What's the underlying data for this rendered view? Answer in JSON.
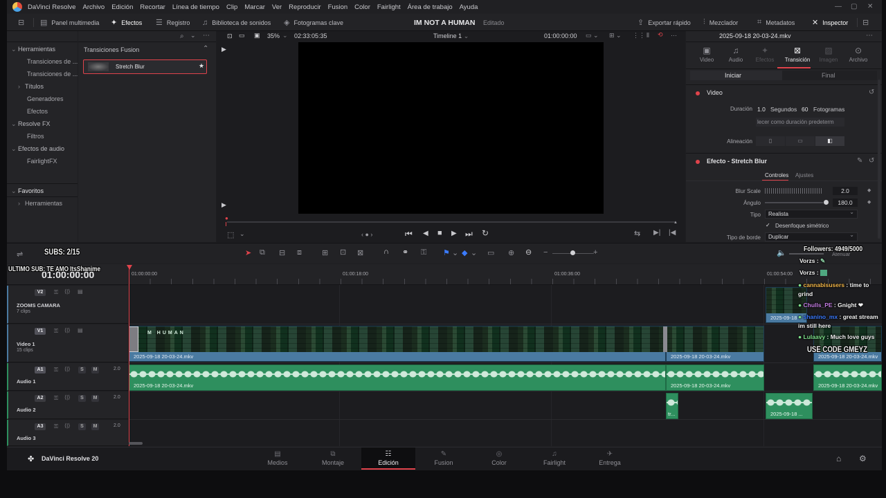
{
  "menu": {
    "app_name": "DaVinci Resolve",
    "items": [
      "Archivo",
      "Edición",
      "Recortar",
      "Línea de tiempo",
      "Clip",
      "Marcar",
      "Ver",
      "Reproducir",
      "Fusion",
      "Color",
      "Fairlight",
      "Área de trabajo",
      "Ayuda"
    ]
  },
  "toolbar": {
    "left": [
      "Panel multimedia",
      "Efectos",
      "Registro",
      "Biblioteca de sonidos",
      "Fotogramas clave"
    ],
    "project_title": "IM NOT A HUMAN",
    "project_status": "Editado",
    "right": [
      "Exportar rápido",
      "Mezclador",
      "Metadatos",
      "Inspector"
    ]
  },
  "effects_library": {
    "tree": {
      "herramientas": "Herramientas",
      "transiciones1": "Transiciones de ...",
      "transiciones2": "Transiciones de ...",
      "titulos": "Títulos",
      "generadores": "Generadores",
      "efectos": "Efectos",
      "resolve_fx": "Resolve FX",
      "filtros": "Filtros",
      "efectos_audio": "Efectos de audio",
      "fairlight_fx": "FairlightFX",
      "favoritos": "Favoritos",
      "fav_herramientas": "Herramientas"
    },
    "section_title": "Transiciones Fusion",
    "selected_item": "Stretch Blur"
  },
  "viewer": {
    "zoom": "35%",
    "source_timecode": "02:33:05:35",
    "timeline_name": "Timeline 1",
    "record_timecode": "01:00:00:00"
  },
  "inspector": {
    "clip_name": "2025-09-18 20-03-24.mkv",
    "tabs": [
      "Video",
      "Audio",
      "Efectos",
      "Transición",
      "Imagen",
      "Archivo"
    ],
    "active_tab": "Transición",
    "subtabs": [
      "Iniciar",
      "Final"
    ],
    "video_section": "Video",
    "duracion_label": "Duración",
    "duracion_value": "1.0",
    "segundos_label": "Segundos",
    "fotogramas_value": "60",
    "fotogramas_label": "Fotogramas",
    "default_button": "lecer como duración predeterm",
    "alineacion_label": "Alineación",
    "effect_section": "Efecto - Stretch Blur",
    "effect_tabs": [
      "Controles",
      "Ajustes"
    ],
    "blur_scale_label": "Blur Scale",
    "blur_scale_value": "2.0",
    "blur_scale_fraction": 0.2,
    "angulo_label": "Ángulo",
    "angulo_value": "180.0",
    "angulo_fraction": 1.0,
    "tipo_label": "Tipo",
    "tipo_value": "Realista",
    "desenfoque_label": "Desenfoque simétrico",
    "tipo_borde_label": "Tipo de borde",
    "tipo_borde_value": "Duplicar"
  },
  "timeline": {
    "current_tc": "01:00:00:00",
    "ruler": [
      "01:00:00:00",
      "01:00:18:00",
      "01:00:36:00",
      "01:00:54:00"
    ],
    "tracks": [
      {
        "id": "V2",
        "name": "ZOOMS CAMARA",
        "clips": "7 clips"
      },
      {
        "id": "V1",
        "name": "Video 1",
        "clips": "15 clips"
      },
      {
        "id": "A1",
        "name": "Audio 1",
        "level": "2.0"
      },
      {
        "id": "A2",
        "name": "Audio 2",
        "level": "2.0"
      },
      {
        "id": "A3",
        "name": "Audio 3",
        "level": "2.0"
      }
    ],
    "clip_name": "2025-09-18 20-03-24.mkv",
    "clip_short": "2025-09-18 ...",
    "clip_tiny": "tr...",
    "v2_clip": "2025-09-18",
    "solo_label": "S",
    "mute_label": "M",
    "thumb_text": "M HUMAN",
    "mixer_label": "Atenuar"
  },
  "pages": [
    "Medios",
    "Montaje",
    "Edición",
    "Fusion",
    "Color",
    "Fairlight",
    "Entrega"
  ],
  "active_page": "Edición",
  "brand": "DaVinci Resolve 20",
  "stream_overlay": {
    "subs": "SUBS: 2/15",
    "last_sub": "ULTIMO SUB: TE AMO ItsShanime",
    "followers": "Followers: 4949/5000",
    "code": "USE CODE GMEYZ",
    "chat": [
      {
        "user": "Vorzs",
        "msg": "",
        "color": "#f2f2f2"
      },
      {
        "user": "Vorzs",
        "msg": "",
        "color": "#f2f2f2"
      },
      {
        "user": "cannabisusers",
        "msg": "time to grind",
        "color": "#f5b84a"
      },
      {
        "user": "Chulls_PE",
        "msg": "Gnight ❤",
        "color": "#c27be0"
      },
      {
        "user": "shanino_mx",
        "msg": "great stream im still here",
        "color": "#3b7bff"
      },
      {
        "user": "Lulaavy",
        "msg": "Much love guys",
        "color": "#7de08a"
      }
    ]
  },
  "colors": {
    "accent": "#e0434b",
    "video_clip": "#4a7aa1",
    "audio_clip": "#2e8f5e",
    "playhead": "#e0434b"
  }
}
